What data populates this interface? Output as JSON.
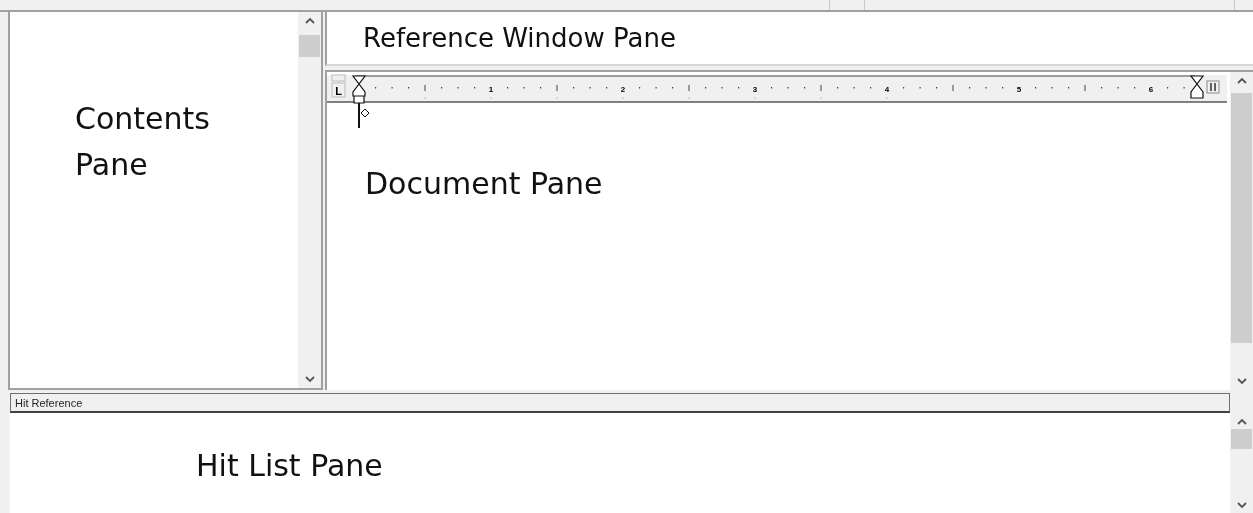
{
  "contents_pane": {
    "label_lines": [
      "Contents",
      "Pane"
    ]
  },
  "reference_window_pane": {
    "label": "Reference Window Pane"
  },
  "document_pane": {
    "ruler": {
      "tab_stop": "L",
      "numbers": [
        "1",
        "2",
        "3",
        "4",
        "5",
        "6"
      ]
    },
    "label": "Document Pane"
  },
  "hit_list_pane": {
    "header": "Hit Reference",
    "label": "Hit List Pane"
  }
}
